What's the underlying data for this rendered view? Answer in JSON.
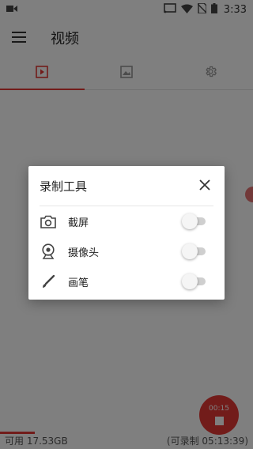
{
  "status_bar": {
    "time": "3:33",
    "icons": [
      "video-camera-icon",
      "cast-icon",
      "wifi-icon",
      "no-sim-icon",
      "battery-icon"
    ]
  },
  "app_bar": {
    "title": "视频",
    "menu_icon": "hamburger-menu-icon"
  },
  "tabs": [
    {
      "icon": "video-icon",
      "active": true
    },
    {
      "icon": "image-icon",
      "active": false
    },
    {
      "icon": "gear-icon",
      "active": false
    }
  ],
  "dialog": {
    "title": "录制工具",
    "items": [
      {
        "label": "截屏",
        "icon": "camera-icon",
        "enabled": false
      },
      {
        "label": "摄像头",
        "icon": "webcam-icon",
        "enabled": false
      },
      {
        "label": "画笔",
        "icon": "brush-icon",
        "enabled": false
      }
    ]
  },
  "bottom_bar": {
    "free_space": "可用 17.53GB",
    "remaining": "(可录制 05:13:39)"
  },
  "fab": {
    "elapsed": "00:15"
  },
  "colors": {
    "accent": "#e53935",
    "scrim": "rgba(0,0,0,0.5)"
  }
}
